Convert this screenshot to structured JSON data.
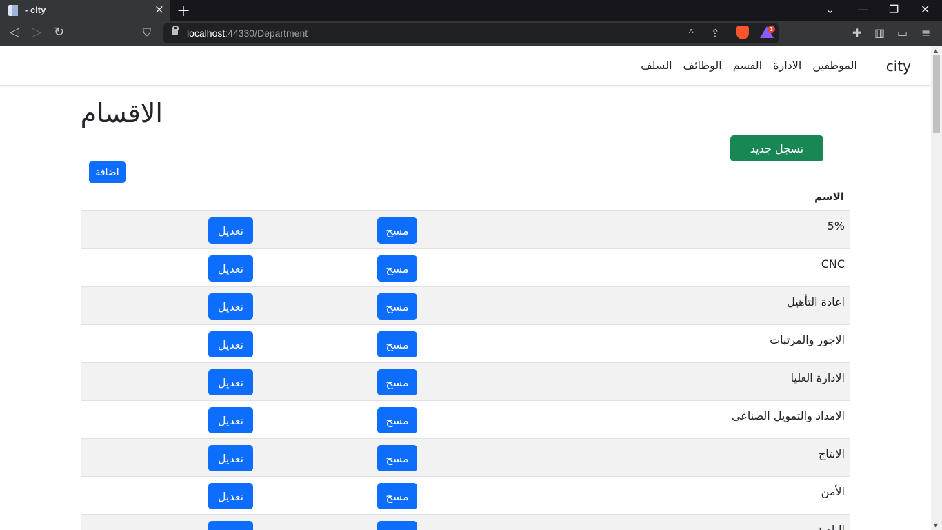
{
  "browser": {
    "tab_title": "- city",
    "url_host": "localhost",
    "url_rest": ":44330/Department",
    "new_tab": "+",
    "tab_close": "×",
    "extension_badge": "1"
  },
  "navbar": {
    "brand": "city",
    "links": [
      "الموظفين",
      "الادارة",
      "القسم",
      "الوظائف",
      "السلف"
    ]
  },
  "page": {
    "heading": "الاقسام",
    "register_button": "تسجل جديد",
    "add_button": "اضافة",
    "column_name": "الاسم"
  },
  "table": {
    "delete_label": "مسح",
    "edit_label": "تعديل",
    "rows": [
      {
        "name": "5%"
      },
      {
        "name": "CNC"
      },
      {
        "name": "اعادة التأهيل"
      },
      {
        "name": "الاجور والمرتبات"
      },
      {
        "name": "الادارة العليا"
      },
      {
        "name": "الامداد والتمويل الصناعى"
      },
      {
        "name": "الانتاج"
      },
      {
        "name": "الأمن"
      },
      {
        "name": "البلدية"
      }
    ]
  }
}
